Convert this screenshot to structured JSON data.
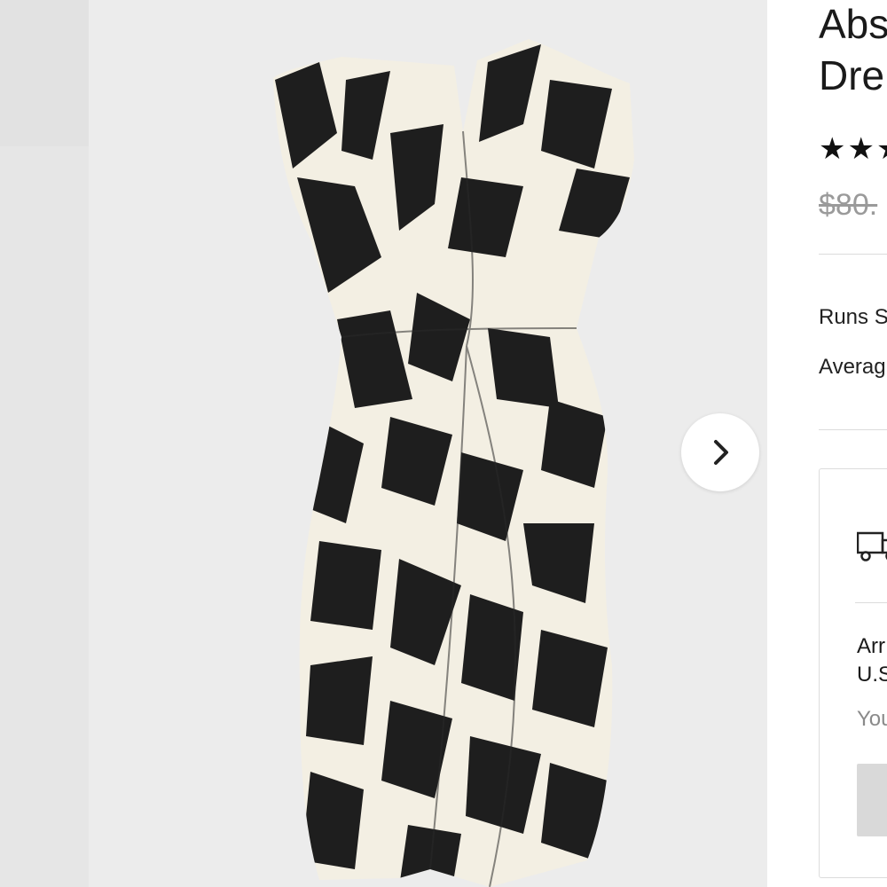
{
  "gallery": {
    "next_button_label": "Next image",
    "icons": {
      "next": "chevron-right-icon"
    }
  },
  "product": {
    "title_line1": "Abs",
    "title_line2": "Dre",
    "rating_stars": "★★★",
    "price": "$80."
  },
  "fit": {
    "size_note": "Runs S",
    "average_note": "Averag"
  },
  "shipping": {
    "icon": "truck-icon",
    "arrives_line1": "Arr",
    "arrives_line2": "U.S",
    "note": "You"
  },
  "colors": {
    "gallery_bg": "#ececec",
    "print_dark": "#1e1e1e",
    "print_light": "#f3efe3"
  }
}
